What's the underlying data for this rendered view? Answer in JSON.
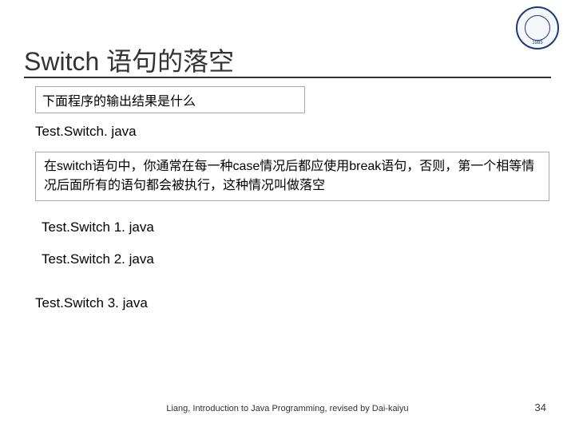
{
  "logo": {
    "year": "1985"
  },
  "title": "Switch 语句的落空",
  "question_box": "下面程序的输出结果是什么",
  "files": {
    "a": "Test.Switch. java",
    "b": "Test.Switch 1. java",
    "c": "Test.Switch 2. java",
    "d": "Test.Switch 3. java"
  },
  "explain_box": "在switch语句中，你通常在每一种case情况后都应使用break语句，否则，第一个相等情况后面所有的语句都会被执行，这种情况叫做落空",
  "footer": "Liang, Introduction to Java Programming, revised by Dai-kaiyu",
  "page_number": "34"
}
